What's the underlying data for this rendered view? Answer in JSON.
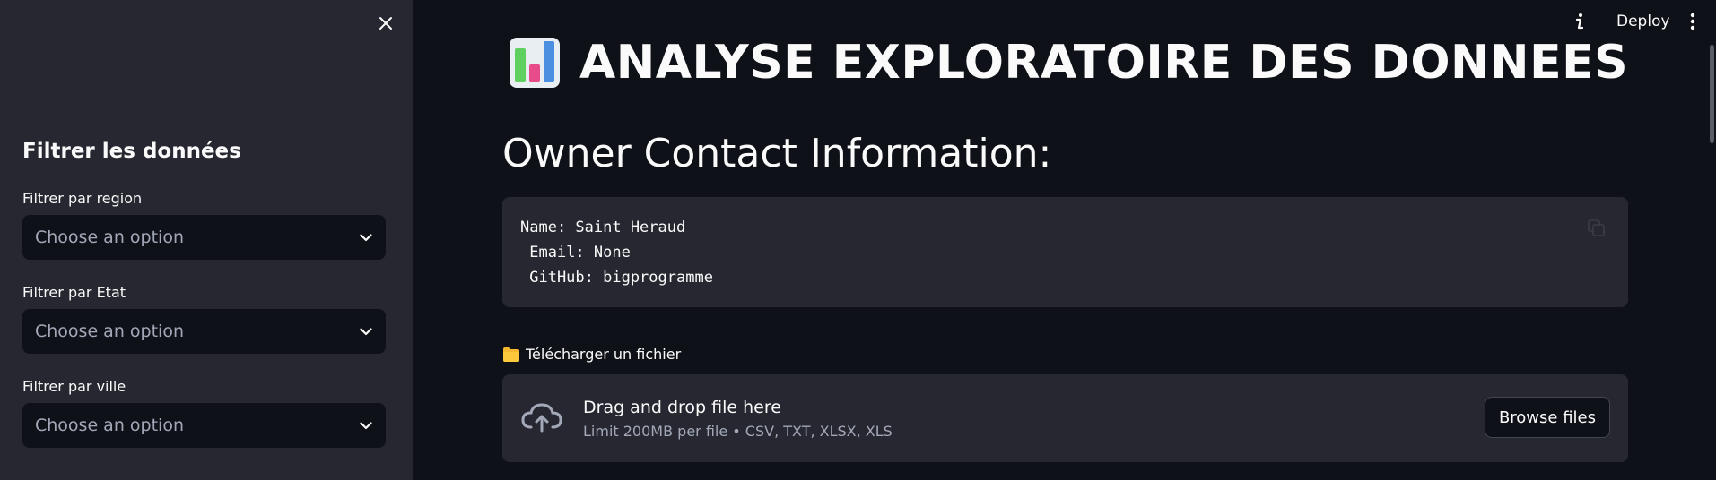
{
  "sidebar": {
    "title": "Filtrer les données",
    "filters": [
      {
        "label": "Filtrer par region",
        "placeholder": "Choose an option"
      },
      {
        "label": "Filtrer par Etat",
        "placeholder": "Choose an option"
      },
      {
        "label": "Filtrer par ville",
        "placeholder": "Choose an option"
      }
    ]
  },
  "header": {
    "deploy_label": "Deploy"
  },
  "main": {
    "title": "ANALYSE EXPLORATOIRE DES DONNEES",
    "title_icon": "bar-chart-icon",
    "section_title": "Owner Contact Information:",
    "code_lines": [
      "Name: Saint Heraud",
      " Email: None",
      " GitHub: bigprogramme"
    ],
    "upload": {
      "label": "Télécharger un fichier",
      "drop_text": "Drag and drop file here",
      "limit_text": "Limit 200MB per file • CSV, TXT, XLSX, XLS",
      "browse_label": "Browse files"
    }
  },
  "colors": {
    "background": "#0e1117",
    "sidebar": "#262730",
    "text": "#fafafa",
    "muted": "#a3a8b8"
  }
}
